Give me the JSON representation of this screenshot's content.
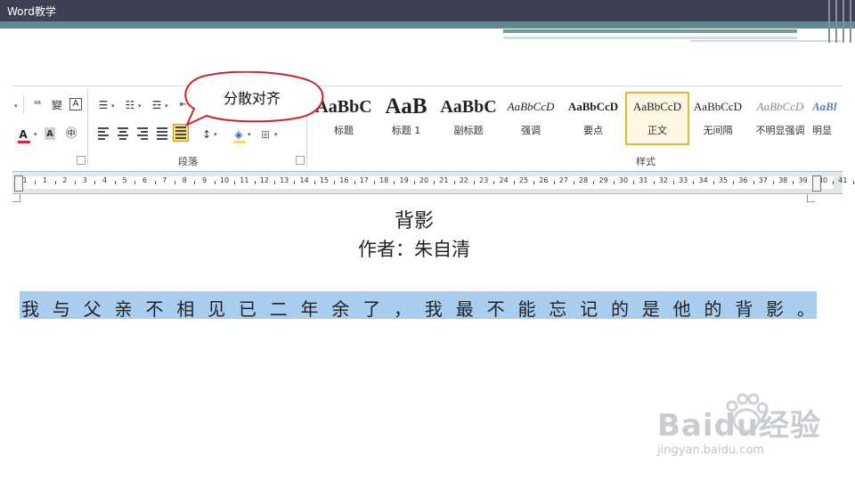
{
  "header": {
    "title": "Word教学"
  },
  "ribbon": {
    "paragraph_group_label": "段落",
    "styles_group_label": "样式",
    "styles": [
      {
        "preview": "AaBbC",
        "name": "标题"
      },
      {
        "preview": "AaB",
        "name": "标题 1"
      },
      {
        "preview": "AaBbC",
        "name": "副标题"
      },
      {
        "preview": "AaBbCcD",
        "name": "强调"
      },
      {
        "preview": "AaBbCcD",
        "name": "要点"
      },
      {
        "preview": "AaBbCcD",
        "name": "正文"
      },
      {
        "preview": "AaBbCcD",
        "name": "无间隔"
      },
      {
        "preview": "AaBbCcD",
        "name": "不明显强调"
      },
      {
        "preview": "AaBl",
        "name": "明显"
      }
    ],
    "selected_style": "正文",
    "font_color": "#d9262a",
    "highlight_color": "#f7d774"
  },
  "callout": {
    "text": "分散对齐"
  },
  "ruler": {
    "numbers": [
      "1",
      "1",
      "2",
      "3",
      "4",
      "5",
      "6",
      "7",
      "8",
      "9",
      "10",
      "11",
      "12",
      "13",
      "14",
      "15",
      "16",
      "17",
      "18",
      "19",
      "20",
      "21",
      "22",
      "23",
      "24",
      "25",
      "26",
      "27",
      "28",
      "29",
      "30",
      "31",
      "32",
      "33",
      "34",
      "35",
      "36",
      "37",
      "38",
      "39",
      "40",
      "41"
    ]
  },
  "document": {
    "title": "背影",
    "author": "作者：朱自清",
    "line_chars": [
      "我",
      "与",
      "父",
      "亲",
      "不",
      "相",
      "见",
      "已",
      "二",
      "年",
      "余",
      "了",
      "，",
      "我",
      "最",
      "不",
      "能",
      "忘",
      "记",
      "的",
      "是",
      "他",
      "的",
      "背",
      "影",
      "。"
    ],
    "selection_color": "#a8cdef"
  },
  "watermark": {
    "brand": "Baidu经验",
    "url": "jingyan.baidu.com"
  }
}
